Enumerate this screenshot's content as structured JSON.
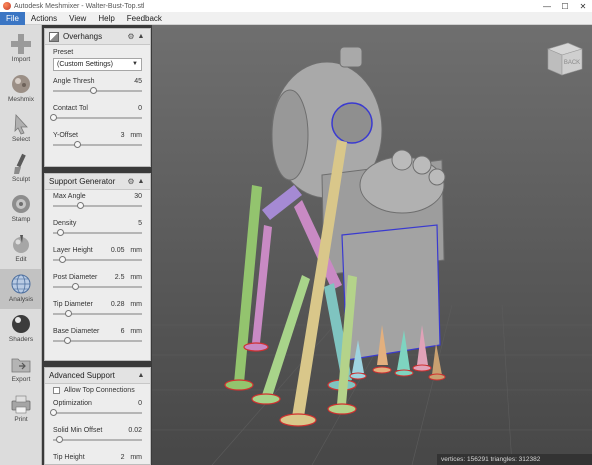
{
  "window": {
    "title": "Autodesk Meshmixer - Walter-Bust-Top.stl",
    "minimize": "—",
    "maximize": "☐",
    "close": "✕"
  },
  "menu": {
    "file": "File",
    "actions": "Actions",
    "view": "View",
    "help": "Help",
    "feedback": "Feedback"
  },
  "tools": {
    "import": "Import",
    "meshmix": "Meshmix",
    "select": "Select",
    "sculpt": "Sculpt",
    "stamp": "Stamp",
    "edit": "Edit",
    "analysis": "Analysis",
    "shaders": "Shaders",
    "export": "Export",
    "print": "Print"
  },
  "overhangs": {
    "title": "Overhangs",
    "preset_label": "Preset",
    "preset_value": "(Custom Settings)",
    "angle_thresh": {
      "label": "Angle Thresh",
      "value": "45",
      "fraction": 0.45
    },
    "contact_tol": {
      "label": "Contact Tol",
      "value": "0",
      "fraction": 0.0
    },
    "y_offset": {
      "label": "Y-Offset",
      "value": "3",
      "unit": "mm",
      "fraction": 0.27
    }
  },
  "support_generator": {
    "title": "Support Generator",
    "max_angle": {
      "label": "Max Angle",
      "value": "30",
      "fraction": 0.3
    },
    "density": {
      "label": "Density",
      "value": "5",
      "fraction": 0.08
    },
    "layer_height": {
      "label": "Layer Height",
      "value": "0.05",
      "unit": "mm",
      "fraction": 0.1
    },
    "post_diameter": {
      "label": "Post Diameter",
      "value": "2.5",
      "unit": "mm",
      "fraction": 0.25
    },
    "tip_diameter": {
      "label": "Tip Diameter",
      "value": "0.28",
      "unit": "mm",
      "fraction": 0.17
    },
    "base_diameter": {
      "label": "Base Diameter",
      "value": "6",
      "unit": "mm",
      "fraction": 0.16
    }
  },
  "advanced_support": {
    "title": "Advanced Support",
    "allow_top_connections": "Allow Top Connections",
    "optimization": {
      "label": "Optimization",
      "value": "0",
      "fraction": 0.0
    },
    "solid_min_offset": {
      "label": "Solid Min Offset",
      "value": "0.02",
      "fraction": 0.07
    },
    "tip_height": {
      "label": "Tip Height",
      "value": "2",
      "unit": "mm"
    }
  },
  "viewport": {
    "viewcube_label": "BACK",
    "status": "vertices: 156291 triangles: 312382"
  },
  "colors": {
    "menu_active": "#3b76c4",
    "panel_bg": "#ededed",
    "viewport_bg": "#4e4e4e"
  }
}
